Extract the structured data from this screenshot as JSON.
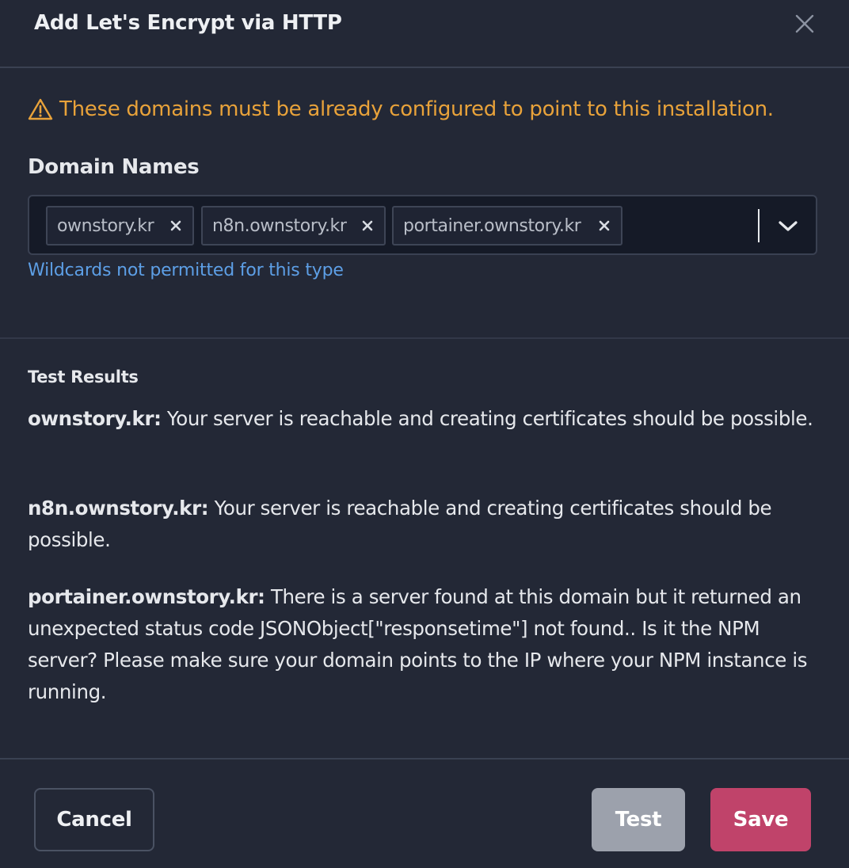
{
  "modal": {
    "title": "Add Let's Encrypt via HTTP"
  },
  "warning": {
    "text": "These domains must be already configured to point to this installation.",
    "color": "#e8a23a"
  },
  "domain_names": {
    "label": "Domain Names",
    "chips": [
      "ownstory.kr",
      "n8n.ownstory.kr",
      "portainer.ownstory.kr"
    ],
    "hint": "Wildcards not permitted for this type"
  },
  "test_results": {
    "title": "Test Results",
    "items": [
      {
        "domain": "ownstory.kr:",
        "message": "Your server is reachable and creating certificates should be possible."
      },
      {
        "domain": "n8n.ownstory.kr:",
        "message": "Your server is reachable and creating certificates should be possible."
      },
      {
        "domain": "portainer.ownstory.kr:",
        "message": "There is a server found at this domain but it returned an unexpected status code JSONObject[\"responsetime\"] not found.. Is it the NPM server? Please make sure your domain points to the IP where your NPM instance is running."
      }
    ]
  },
  "footer": {
    "cancel_label": "Cancel",
    "test_label": "Test",
    "save_label": "Save"
  },
  "colors": {
    "background": "#232836",
    "accent_save": "#c0436a",
    "test_button": "#9ca1ac",
    "hint_link": "#5d9fe6"
  },
  "icons": {
    "close": "close-icon",
    "warning": "warning-triangle-icon",
    "chip_remove": "remove-x-icon",
    "dropdown": "chevron-down-icon"
  }
}
